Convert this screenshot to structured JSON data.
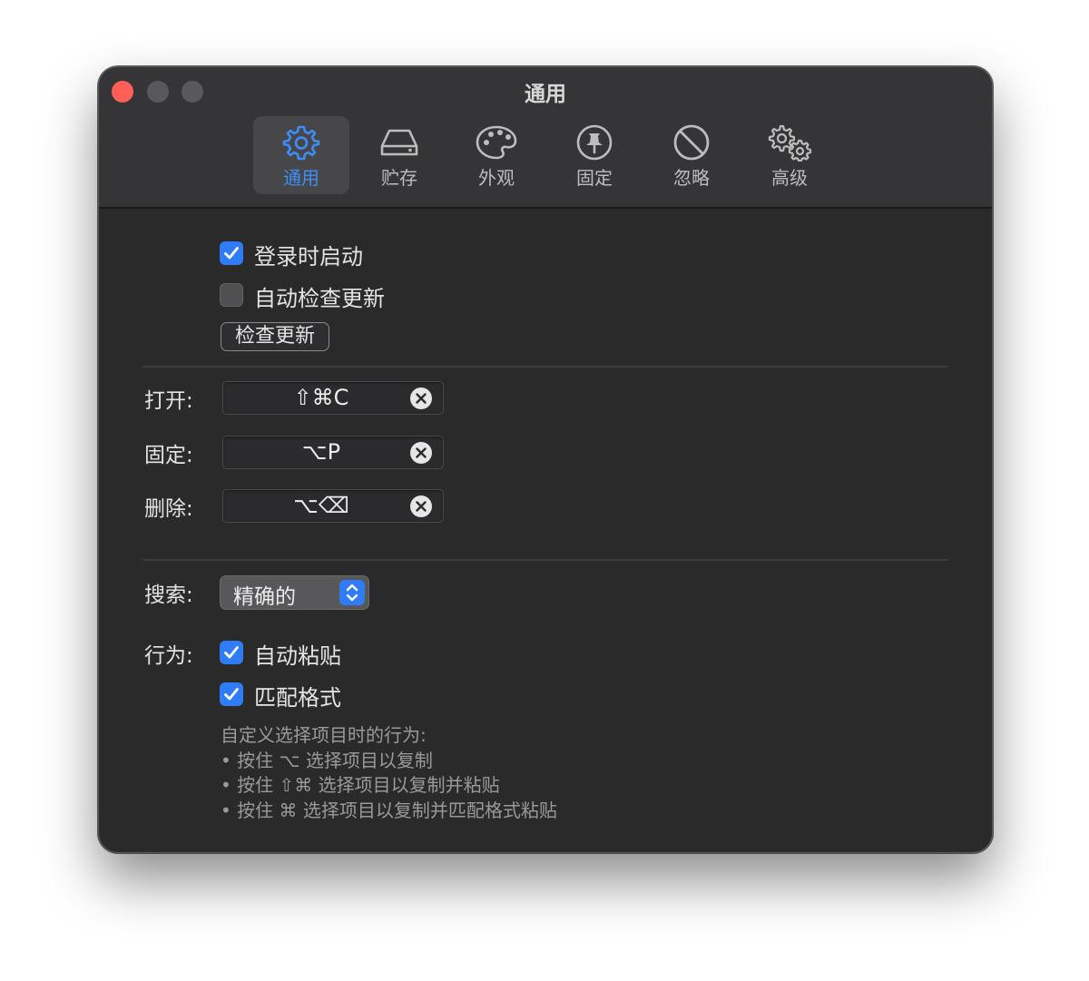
{
  "window": {
    "title": "通用"
  },
  "tabs": [
    {
      "label": "通用",
      "icon": "gear-icon",
      "active": true
    },
    {
      "label": "贮存",
      "icon": "drive-icon",
      "active": false
    },
    {
      "label": "外观",
      "icon": "palette-icon",
      "active": false
    },
    {
      "label": "固定",
      "icon": "pin-icon",
      "active": false
    },
    {
      "label": "忽略",
      "icon": "prohibit-icon",
      "active": false
    },
    {
      "label": "高级",
      "icon": "gears-icon",
      "active": false
    }
  ],
  "general": {
    "launch_at_login": {
      "label": "登录时启动",
      "checked": true
    },
    "auto_check_updates": {
      "label": "自动检查更新",
      "checked": false
    },
    "check_updates_button": "检查更新"
  },
  "shortcuts": [
    {
      "label": "打开:",
      "keys": "⇧⌘C"
    },
    {
      "label": "固定:",
      "keys": "⌥P"
    },
    {
      "label": "删除:",
      "keys": "⌥⌫"
    }
  ],
  "search": {
    "label": "搜索:",
    "value": "精确的"
  },
  "behavior": {
    "label": "行为:",
    "auto_paste": {
      "label": "自动粘贴",
      "checked": true
    },
    "match_format": {
      "label": "匹配格式",
      "checked": true
    },
    "hint_title": "自定义选择项目时的行为:",
    "hint_lines": [
      "• 按住 ⌥ 选择项目以复制",
      "• 按住 ⇧⌘ 选择项目以复制并粘贴",
      "• 按住 ⌘ 选择项目以复制并匹配格式粘贴"
    ]
  },
  "colors": {
    "accent": "#2f7cf6",
    "close": "#ff5f57",
    "window_bg": "#2a2a2b"
  }
}
